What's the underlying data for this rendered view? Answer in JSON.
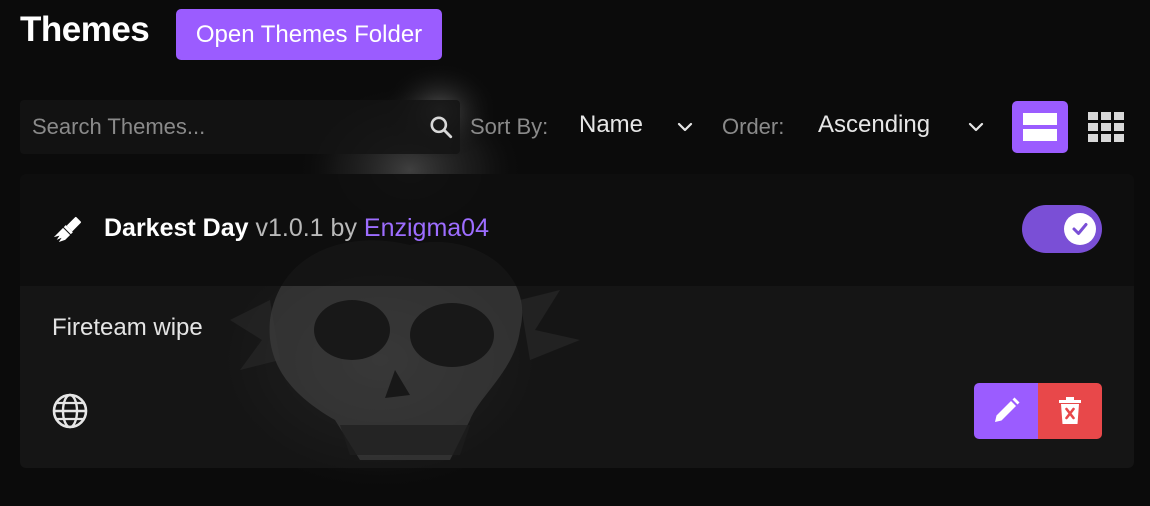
{
  "header": {
    "title": "Themes",
    "open_folder_label": "Open Themes Folder"
  },
  "search": {
    "placeholder": "Search Themes...",
    "value": ""
  },
  "controls": {
    "sort_label": "Sort By:",
    "sort_value": "Name",
    "order_label": "Order:",
    "order_value": "Ascending",
    "view_mode": "list"
  },
  "theme": {
    "name": "Darkest Day",
    "version": "v1.0.1",
    "by": "by",
    "author": "Enzigma04",
    "description": "Fireteam wipe",
    "enabled": true
  },
  "colors": {
    "accent": "#9b5cff",
    "danger": "#e8484a",
    "author_link": "#9d6dff"
  },
  "icons": [
    "search-icon",
    "chevron-down-icon",
    "list-view-icon",
    "grid-view-icon",
    "paintbrush-icon",
    "check-icon",
    "globe-icon",
    "pencil-icon",
    "trash-icon"
  ]
}
